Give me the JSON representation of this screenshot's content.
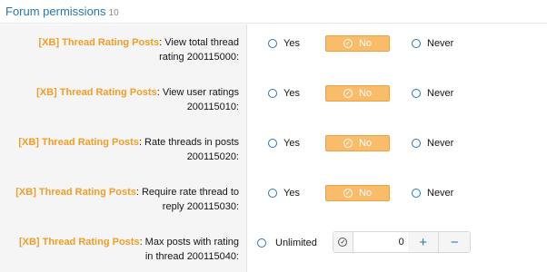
{
  "section": {
    "title": "Forum permissions",
    "count": "10"
  },
  "options": {
    "yes": "Yes",
    "no": "No",
    "never": "Never",
    "unlimited": "Unlimited"
  },
  "permissions": [
    {
      "addon": "[XB] Thread Rating Posts",
      "text1": ": View total thread",
      "text2": "rating 200115000:"
    },
    {
      "addon": "[XB] Thread Rating Posts",
      "text1": ": View user ratings",
      "text2": "200115010:"
    },
    {
      "addon": "[XB] Thread Rating Posts",
      "text1": ": Rate threads in posts",
      "text2": "200115020:"
    },
    {
      "addon": "[XB] Thread Rating Posts",
      "text1": ": Require rate thread to",
      "text2": "reply 200115030:"
    },
    {
      "addon": "[XB] Thread Rating Posts",
      "text1": ": Max posts with rating",
      "text2": "in thread 200115040:"
    }
  ],
  "stepper": {
    "value": "0",
    "plus": "+",
    "minus": "−"
  },
  "colors": {
    "accent": "#2577b1",
    "addon": "#f29d28",
    "selected": "#f9bc6a"
  }
}
